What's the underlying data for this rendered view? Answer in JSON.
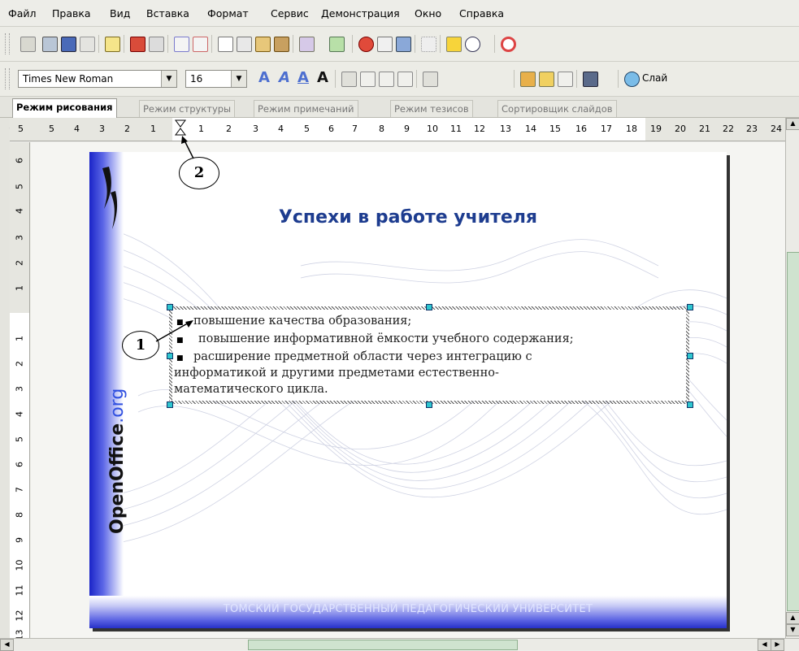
{
  "menu": [
    "Файл",
    "Правка",
    "Вид",
    "Вставка",
    "Формат",
    "Сервис",
    "Демонстрация",
    "Окно",
    "Справка"
  ],
  "format_toolbar": {
    "font_name": "Times New Roman",
    "font_size": "16",
    "slide_label": "Слай"
  },
  "tabs": [
    "Режим рисования",
    "Режим структуры",
    "Режим примечаний",
    "Режим тезисов",
    "Сортировщик слайдов"
  ],
  "ruler_h": [
    "5",
    "5",
    "4",
    "3",
    "2",
    "1",
    "1",
    "2",
    "3",
    "4",
    "5",
    "6",
    "7",
    "8",
    "9",
    "10",
    "11",
    "12",
    "13",
    "14",
    "15",
    "16",
    "17",
    "18",
    "19",
    "20",
    "21",
    "22",
    "23",
    "24"
  ],
  "ruler_v_top": [
    "6",
    "5",
    "4",
    "3",
    "2",
    "1"
  ],
  "ruler_v_bottom": [
    "1",
    "2",
    "3",
    "4",
    "5",
    "6",
    "7",
    "8",
    "9",
    "10",
    "11",
    "12",
    "13"
  ],
  "slide": {
    "title": "Успехи в работе учителя",
    "brand_main": "OpenOffice",
    "brand_suffix": ".org",
    "footer": "ТОМСКИЙ ГОСУДАРСТВЕННЫЙ ПЕДАГОГИЧЕСКИЙ УНИВЕРСИТЕТ",
    "bullets": [
      "повышение качества образования;",
      "повышение информативной ёмкости учебного содержания;",
      "расширение предметной области через интеграцию с"
    ],
    "continuation": [
      "информатикой и другими предметами естественно-",
      "математического цикла."
    ]
  },
  "callouts": [
    "1",
    "2"
  ],
  "colors": {
    "title": "#1d3c8f",
    "selection_handle": "#2ec6cf",
    "slide_gradient": "#1a24c8"
  }
}
